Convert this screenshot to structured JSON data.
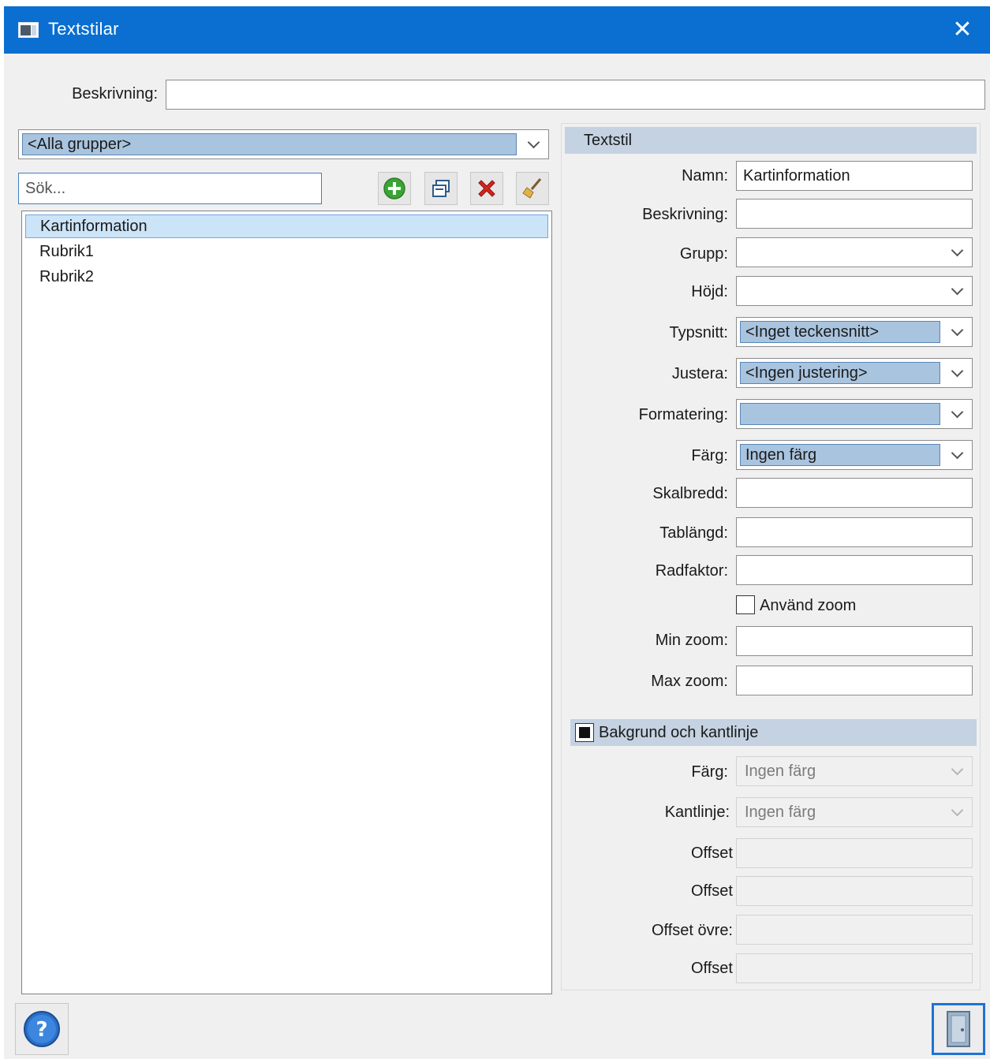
{
  "window": {
    "title": "Textstilar",
    "close_icon": "close-icon"
  },
  "top": {
    "description_label": "Beskrivning:",
    "description_value": ""
  },
  "left": {
    "group_filter": "<Alla grupper>",
    "search_placeholder": "Sök...",
    "search_value": "",
    "toolbar": [
      "add-icon",
      "duplicate-icon",
      "delete-icon",
      "clear-icon"
    ],
    "items": [
      "Kartinformation",
      "Rubrik1",
      "Rubrik2"
    ],
    "selected_index": 0
  },
  "textstil": {
    "header": "Textstil",
    "fields": {
      "namn": {
        "label": "Namn:",
        "value": "Kartinformation"
      },
      "beskrivning": {
        "label": "Beskrivning:",
        "value": ""
      },
      "grupp": {
        "label": "Grupp:",
        "value": ""
      },
      "hojd": {
        "label": "Höjd:",
        "value": ""
      },
      "typsnitt": {
        "label": "Typsnitt:",
        "value": "<Inget teckensnitt>"
      },
      "justera": {
        "label": "Justera:",
        "value": "<Ingen justering>"
      },
      "formatering": {
        "label": "Formatering:",
        "value": ""
      },
      "farg": {
        "label": "Färg:",
        "value": "Ingen färg"
      },
      "skalbredd": {
        "label": "Skalbredd:",
        "value": ""
      },
      "tablangd": {
        "label": "Tablängd:",
        "value": ""
      },
      "radfaktor": {
        "label": "Radfaktor:",
        "value": ""
      },
      "anvand_zoom": {
        "label": "Använd zoom",
        "checked": false
      },
      "min_zoom": {
        "label": "Min zoom:",
        "value": ""
      },
      "max_zoom": {
        "label": "Max zoom:",
        "value": ""
      }
    }
  },
  "bakgrund": {
    "header": "Bakgrund och kantlinje",
    "checked": true,
    "fields": {
      "farg": {
        "label": "Färg:",
        "value": "Ingen färg"
      },
      "kantlinje": {
        "label": "Kantlinje:",
        "value": "Ingen färg"
      },
      "offset1": {
        "label": "Offset",
        "value": ""
      },
      "offset2": {
        "label": "Offset",
        "value": ""
      },
      "offset_ovre": {
        "label": "Offset övre:",
        "value": ""
      },
      "offset3": {
        "label": "Offset",
        "value": ""
      }
    }
  },
  "footer": {
    "help_icon": "help-icon",
    "exit_icon": "exit-door-icon"
  },
  "colors": {
    "titlebar": "#0a6fd0",
    "section_header": "#c4d2e2",
    "selection": "#cce4f7",
    "combo_highlight": "#a9c4df"
  }
}
